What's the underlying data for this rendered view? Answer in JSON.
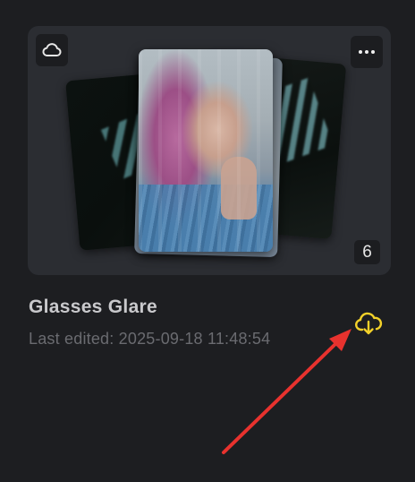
{
  "card": {
    "title": "Glasses Glare",
    "last_edited": "Last edited: 2025-09-18 11:48:54",
    "photo_count": "6"
  },
  "icons": {
    "cloud": "cloud-icon",
    "more": "more-horizontal-icon",
    "download": "cloud-download-icon"
  },
  "colors": {
    "background": "#1d1e21",
    "card": "#2b2d32",
    "download_accent": "#f3d12a",
    "annotation_arrow": "#e8322e"
  }
}
